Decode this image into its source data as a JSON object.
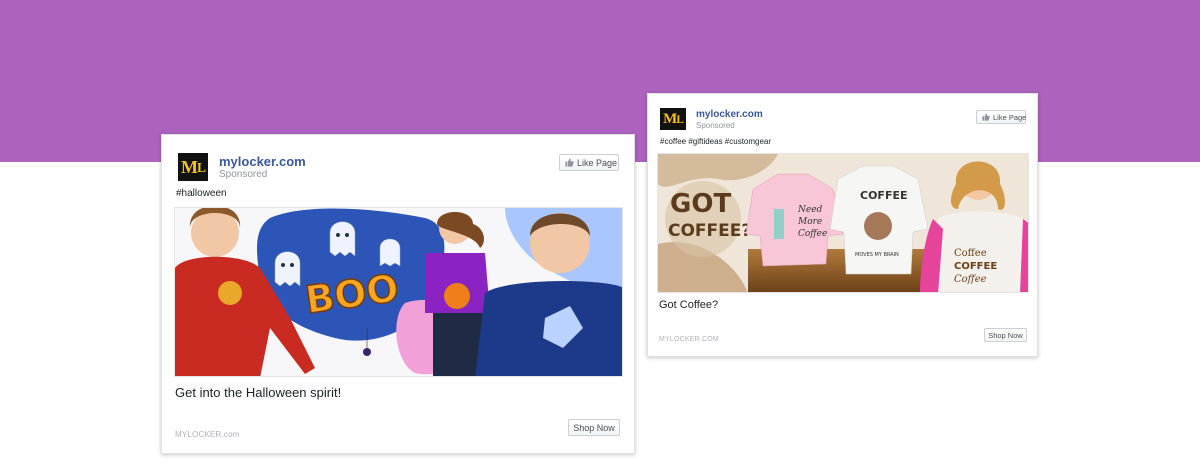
{
  "ads": [
    {
      "page_name": "mylocker.com",
      "sponsored": "Sponsored",
      "like_label": "Like Page",
      "hashtags": "#halloween",
      "image_text": "BOO",
      "headline": "Get into the Halloween spirit!",
      "domain": "MYLOCKER.com",
      "cta": "Shop Now"
    },
    {
      "page_name": "mylocker.com",
      "sponsored": "Sponsored",
      "like_label": "Like Page",
      "hashtags": "#coffee #giftideas #customgear",
      "image_text": {
        "got": "GOT",
        "coffee_q": "COFFEE?",
        "need": "Need",
        "more": "More",
        "coffee_shirt": "Coffee",
        "coffee_caps": "COFFEE",
        "moves": "MOVES MY BRAIN",
        "line1": "Coffee",
        "line2": "COFFEE",
        "line3": "Coffee"
      },
      "headline": "Got Coffee?",
      "domain": "MYLOCKER.COM",
      "cta": "Shop Now"
    }
  ],
  "logo": {
    "m": "M",
    "l": "L"
  },
  "colors": {
    "background_band": "#ad62be",
    "link_blue": "#3b5998",
    "logo_yellow": "#f6c31a"
  }
}
